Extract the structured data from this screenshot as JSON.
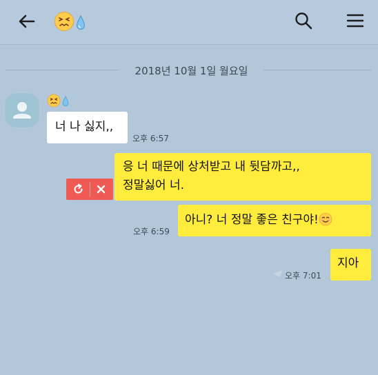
{
  "header": {
    "back_icon": "back-arrow-icon",
    "title_emojis": [
      "persevering-face-emoji",
      "droplet-emoji"
    ],
    "search_icon": "search-icon",
    "menu_icon": "hamburger-menu-icon"
  },
  "date_divider": "2018년 10월 1일 월요일",
  "messages": [
    {
      "side": "left",
      "text": "너 나 싫지,,",
      "time": "오후 6:57"
    },
    {
      "side": "right",
      "line1": "응 너 때문에 상처받고 내 뒷담까고,,",
      "line2": "정말싫어 너.",
      "status": "failed"
    },
    {
      "side": "right",
      "text": "아니? 너 정말 좋은 친구야!",
      "time": "오후 6:59"
    },
    {
      "side": "right",
      "text": "지아",
      "time": "오후 7:01"
    }
  ],
  "colors": {
    "background": "#b2c7da",
    "my_bubble": "#ffec3d",
    "other_bubble": "#ffffff",
    "fail": "#ef5a55"
  }
}
